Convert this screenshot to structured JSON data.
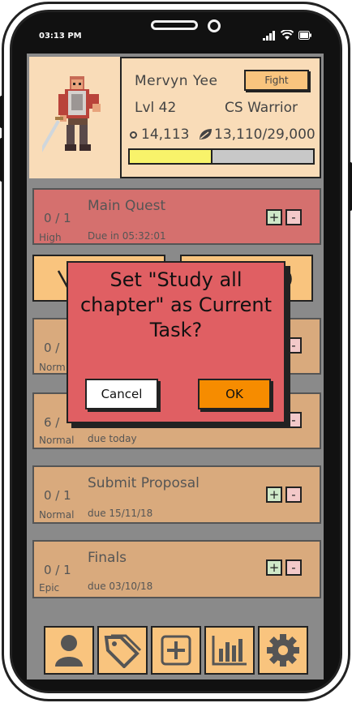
{
  "status_bar": {
    "time": "03:13 PM"
  },
  "profile": {
    "name": "Mervyn Yee",
    "fight_label": "Fight",
    "level": "Lvl 42",
    "class": "CS Warrior",
    "coins": "14,113",
    "xp": "13,110/29,000",
    "xp_progress": 0.452
  },
  "quests": [
    {
      "count": "0 / 1",
      "title": "Main Quest",
      "due": "Due in 05:32:01",
      "difficulty": "High"
    },
    {
      "count": "0 /",
      "title": "",
      "due": "",
      "difficulty": "Norm"
    },
    {
      "count": "6 /",
      "title": "",
      "due": "due today",
      "difficulty": "Normal"
    },
    {
      "count": "0 / 1",
      "title": "Submit Proposal",
      "due": "due 15/11/18",
      "difficulty": "Normal"
    },
    {
      "count": "0 / 1",
      "title": "Finals",
      "due": "due 03/10/18",
      "difficulty": "Epic"
    }
  ],
  "controls": {
    "plus": "+",
    "minus": "-"
  },
  "dialog": {
    "line1": "Set \"Study all",
    "line2": "chapter\" as Current",
    "line3": "Task?",
    "cancel_label": "Cancel",
    "ok_label": "OK"
  },
  "colors": {
    "profile_bg": "#f9dcb8",
    "quest_bg": "#d9aa7d",
    "main_quest_bg": "#d5706e",
    "dialog_bg": "#e05f63",
    "ok_button": "#f68c00",
    "xp_fill": "#f8f36a",
    "tab_bg": "#f9c47e"
  },
  "tabs": [
    {
      "icon": "user-icon"
    },
    {
      "icon": "tags-icon"
    },
    {
      "icon": "add-icon"
    },
    {
      "icon": "stats-icon"
    },
    {
      "icon": "gear-icon"
    }
  ]
}
